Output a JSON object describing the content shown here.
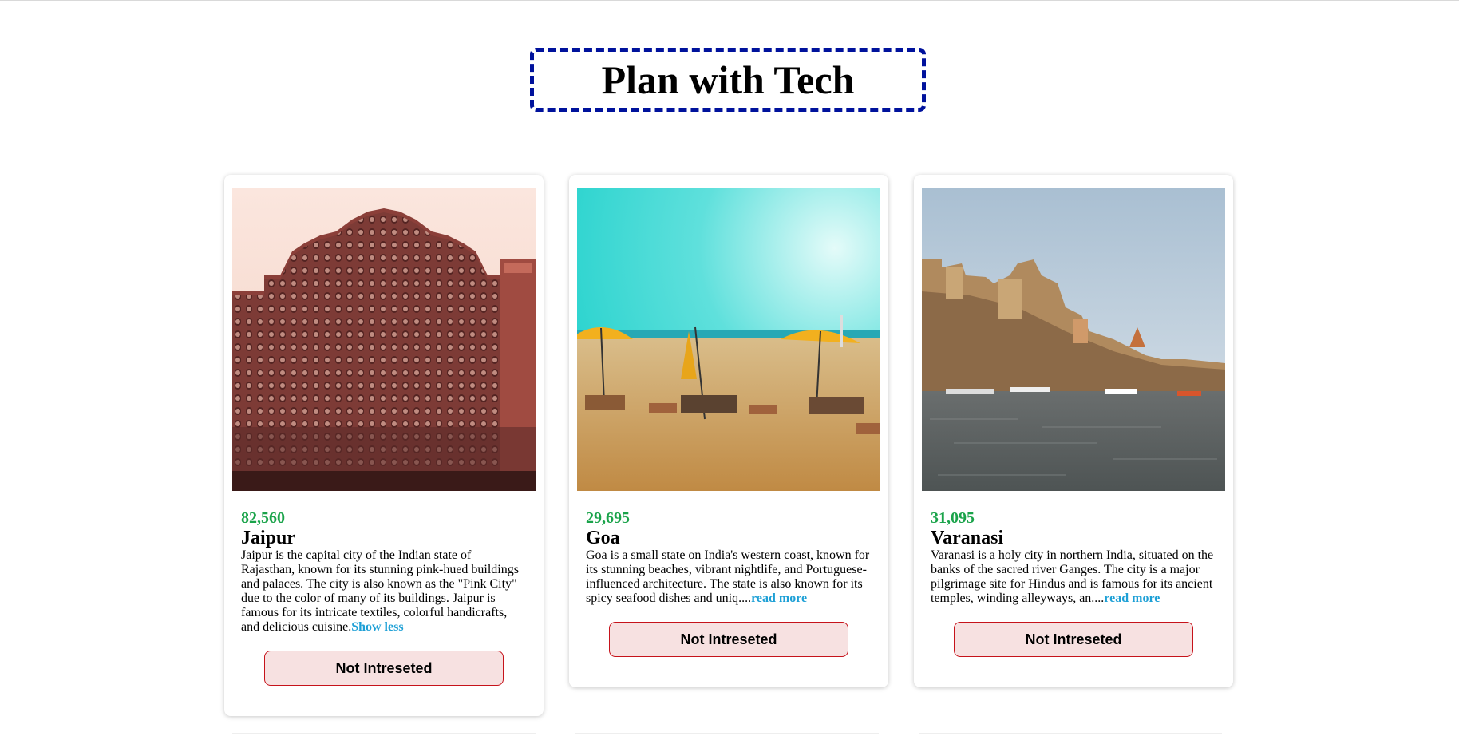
{
  "header": {
    "title": "Plan with Tech"
  },
  "colors": {
    "title_border": "#00129c",
    "price": "#1aa34a",
    "link": "#1ea0d6",
    "button_bg": "#f7e1e1",
    "button_border": "#c6131b"
  },
  "tours": [
    {
      "price": "82,560",
      "name": "Jaipur",
      "description": "Jaipur is the capital city of the Indian state of Rajasthan, known for its stunning pink-hued buildings and palaces. The city is also known as the \"Pink City\" due to the color of many of its buildings. Jaipur is famous for its intricate textiles, colorful handicrafts, and delicious cuisine.",
      "toggle_label": "Show less",
      "button_label": "Not Intreseted",
      "image_icon": "palace-photo-icon"
    },
    {
      "price": "29,695",
      "name": "Goa",
      "description": "Goa is a small state on India's western coast, known for its stunning beaches, vibrant nightlife, and Portuguese-influenced architecture. The state is also known for its spicy seafood dishes and uniq....",
      "toggle_label": "read more",
      "button_label": "Not Intreseted",
      "image_icon": "beach-photo-icon"
    },
    {
      "price": "31,095",
      "name": "Varanasi",
      "description": "Varanasi is a holy city in northern India, situated on the banks of the sacred river Ganges. The city is a major pilgrimage site for Hindus and is famous for its ancient temples, winding alleyways, an....",
      "toggle_label": "read more",
      "button_label": "Not Intreseted",
      "image_icon": "river-ghats-photo-icon"
    }
  ]
}
